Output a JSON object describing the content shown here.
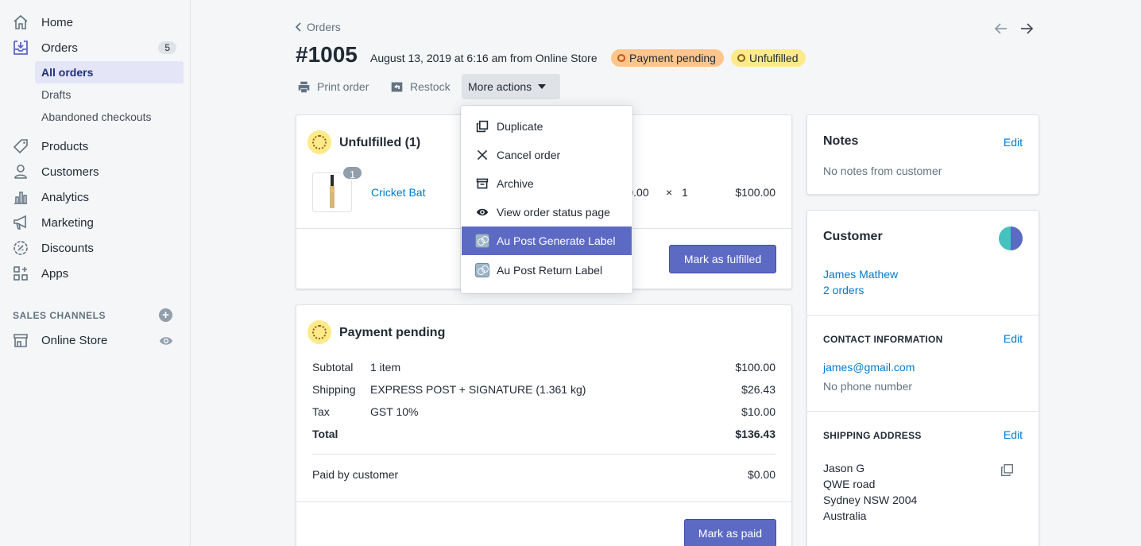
{
  "sidebar": {
    "items": [
      {
        "label": "Home",
        "icon": "home-icon"
      },
      {
        "label": "Orders",
        "icon": "orders-icon",
        "badge": "5"
      },
      {
        "label": "Products",
        "icon": "tag-icon"
      },
      {
        "label": "Customers",
        "icon": "person-icon"
      },
      {
        "label": "Analytics",
        "icon": "bar-chart-icon"
      },
      {
        "label": "Marketing",
        "icon": "megaphone-icon"
      },
      {
        "label": "Discounts",
        "icon": "discount-icon"
      },
      {
        "label": "Apps",
        "icon": "apps-icon"
      }
    ],
    "orders_sub": [
      "All orders",
      "Drafts",
      "Abandoned checkouts"
    ],
    "sales_channels_heading": "SALES CHANNELS",
    "online_store": "Online Store"
  },
  "header": {
    "back_label": "Orders",
    "order_number": "#1005",
    "order_meta": "August 13, 2019 at 6:16 am from Online Store",
    "badge_payment": "Payment pending",
    "badge_fulfillment": "Unfulfilled",
    "print_label": "Print order",
    "restock_label": "Restock",
    "more_actions_label": "More actions"
  },
  "dropdown": {
    "items": [
      {
        "label": "Duplicate",
        "icon": "duplicate-icon"
      },
      {
        "label": "Cancel order",
        "icon": "close-icon"
      },
      {
        "label": "Archive",
        "icon": "archive-icon"
      },
      {
        "label": "View order status page",
        "icon": "eye-icon"
      },
      {
        "label": "Au Post Generate Label",
        "icon": "app-icon",
        "highlighted": true
      },
      {
        "label": "Au Post Return Label",
        "icon": "app-icon"
      }
    ]
  },
  "unfulfilled_card": {
    "title": "Unfulfilled (1)",
    "item_name": "Cricket Bat",
    "quantity_badge": "1",
    "unit_price": "$100.00",
    "times": "×",
    "qty": "1",
    "line_total": "$100.00",
    "button": "Mark as fulfilled"
  },
  "payment_card": {
    "title": "Payment pending",
    "rows": [
      {
        "label": "Subtotal",
        "detail": "1 item",
        "amount": "$100.00"
      },
      {
        "label": "Shipping",
        "detail": "EXPRESS POST + SIGNATURE (1.361 kg)",
        "amount": "$26.43"
      },
      {
        "label": "Tax",
        "detail": "GST 10%",
        "amount": "$10.00"
      },
      {
        "label": "Total",
        "detail": "",
        "amount": "$136.43"
      }
    ],
    "paid_label": "Paid by customer",
    "paid_amount": "$0.00",
    "button": "Mark as paid"
  },
  "notes_card": {
    "title": "Notes",
    "edit": "Edit",
    "text": "No notes from customer"
  },
  "customer_card": {
    "title": "Customer",
    "name": "James Mathew",
    "orders": "2 orders",
    "contact_heading": "CONTACT INFORMATION",
    "contact_edit": "Edit",
    "email": "james@gmail.com",
    "phone": "No phone number",
    "shipping_heading": "SHIPPING ADDRESS",
    "shipping_edit": "Edit",
    "address": [
      "Jason G",
      "QWE road",
      "Sydney NSW 2004",
      "Australia"
    ]
  },
  "colors": {
    "primary": "#5c6ac4",
    "link": "#007ace",
    "badge_orange": "#ffc58b",
    "badge_yellow": "#ffea8a"
  }
}
